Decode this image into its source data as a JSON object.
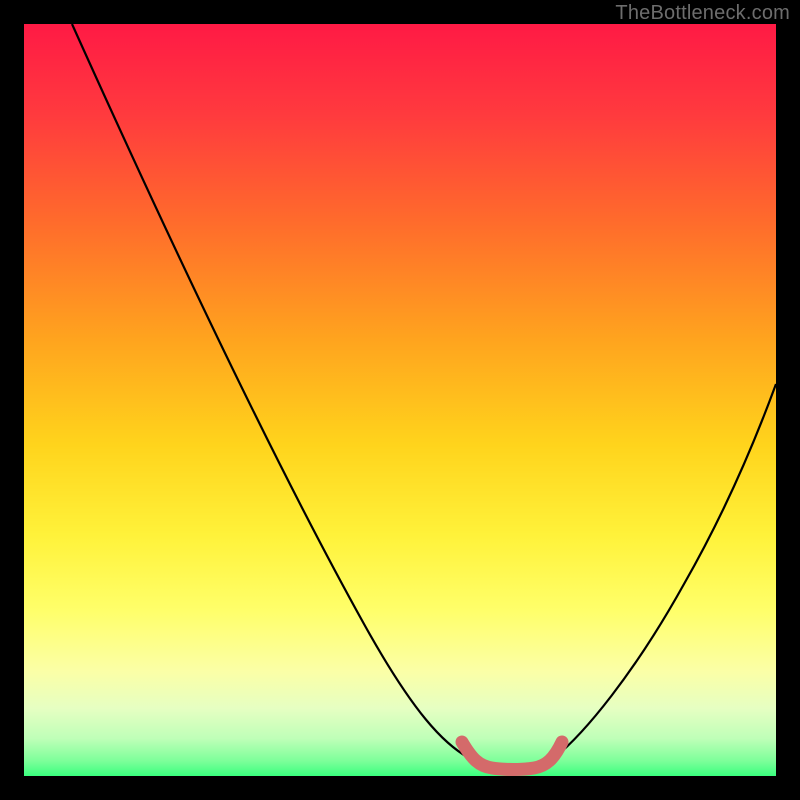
{
  "watermark": {
    "text": "TheBottleneck.com"
  },
  "chart_data": {
    "type": "line",
    "title": "",
    "xlabel": "",
    "ylabel": "",
    "xlim": [
      0,
      100
    ],
    "ylim": [
      0,
      100
    ],
    "grid": false,
    "legend": false,
    "note": "Bottleneck-style V curve: left and right arms rise from a flat minimum near the bottom; minimum band highlighted in salmon.",
    "series": [
      {
        "name": "left-arm",
        "x": [
          6,
          10,
          15,
          20,
          25,
          30,
          35,
          40,
          45,
          50,
          54,
          57,
          59,
          60
        ],
        "y": [
          100,
          93,
          84,
          74,
          64,
          54,
          44,
          34,
          24,
          14,
          6,
          2,
          0.5,
          0
        ]
      },
      {
        "name": "right-arm",
        "x": [
          70,
          72,
          75,
          78,
          82,
          86,
          90,
          94,
          98,
          100
        ],
        "y": [
          0,
          2,
          6,
          12,
          20,
          28,
          36,
          44,
          52,
          56
        ]
      },
      {
        "name": "minimum-band",
        "x": [
          58,
          60,
          62,
          64,
          66,
          68,
          70,
          71
        ],
        "y": [
          3,
          0.5,
          0,
          0,
          0,
          0,
          0.5,
          3
        ]
      }
    ],
    "colors": {
      "curve": "#000000",
      "minimum_band": "#d46a6a",
      "background_gradient": [
        "#ff1a45",
        "#ff6a2c",
        "#ffd41c",
        "#ffff6a",
        "#3aff7e"
      ]
    }
  }
}
